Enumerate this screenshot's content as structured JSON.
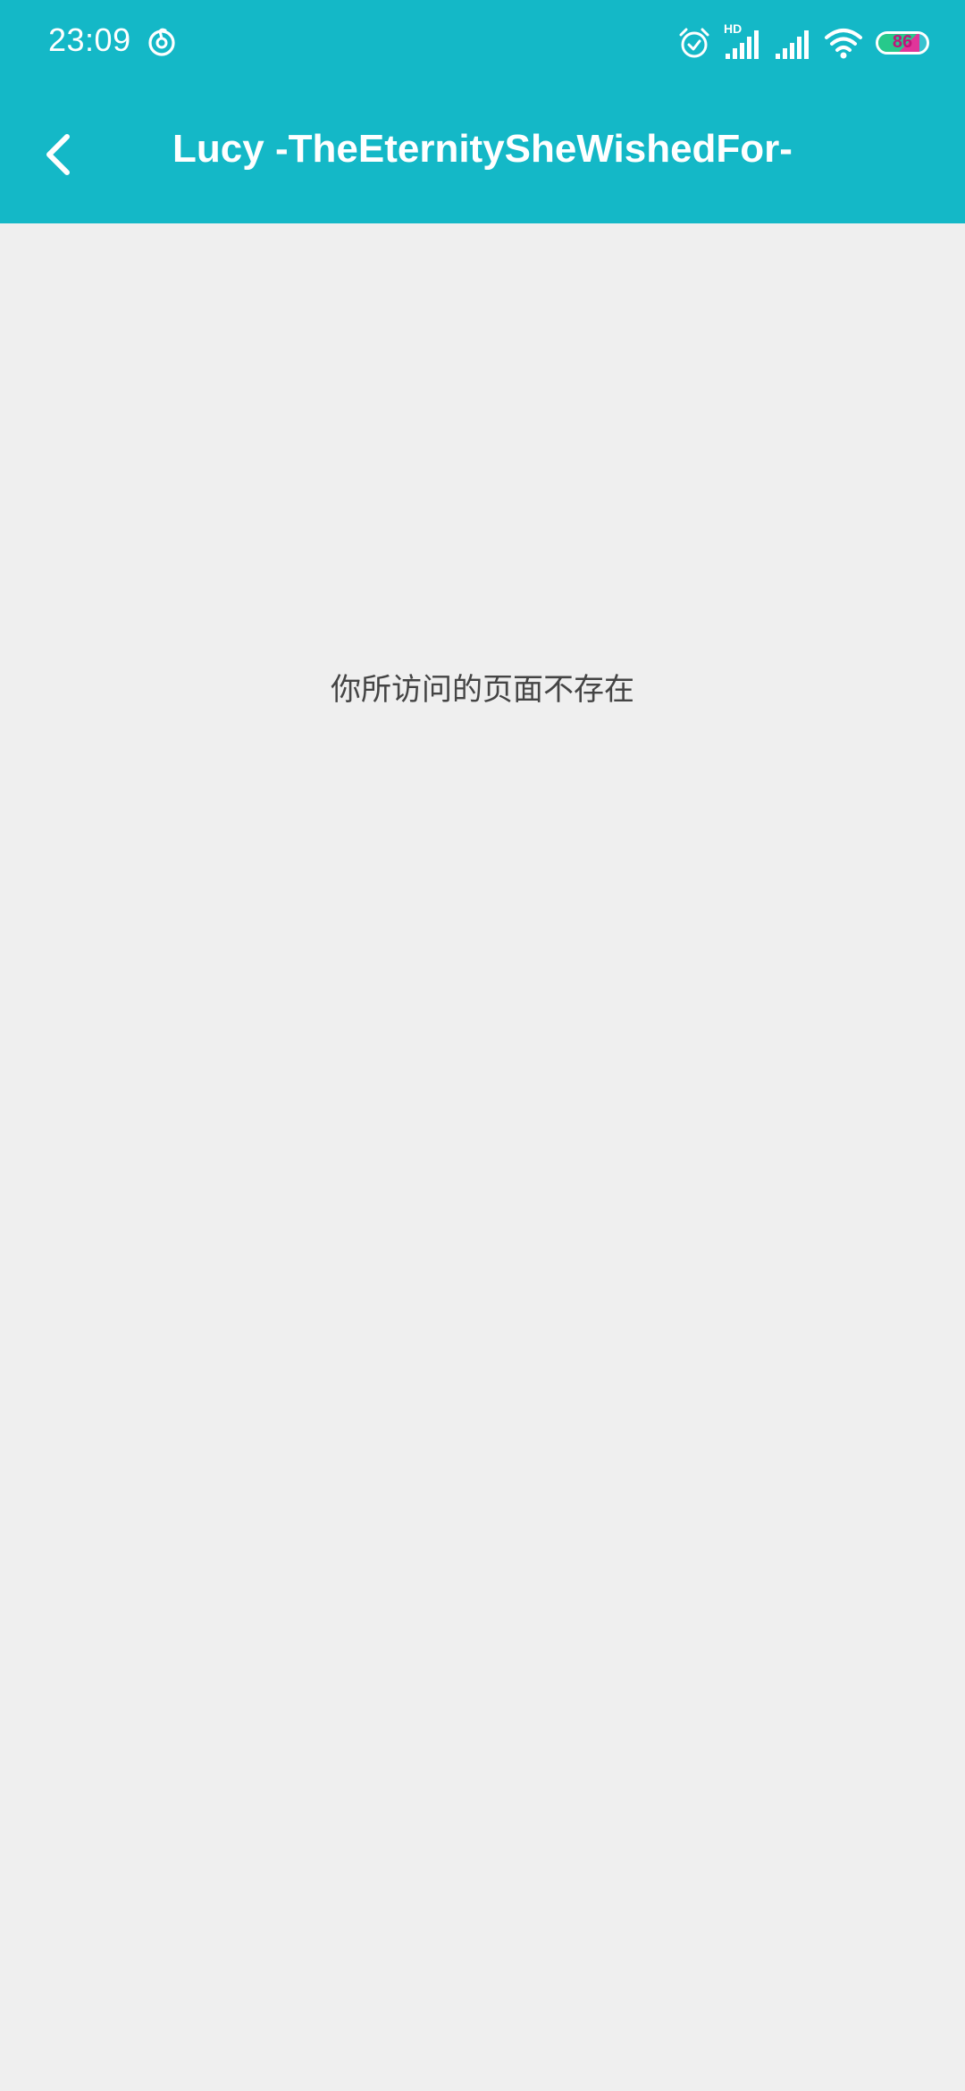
{
  "status_bar": {
    "time": "23:09",
    "network_label": "HD",
    "battery_level": "86",
    "icons": [
      "netease-music-icon",
      "alarm-icon",
      "signal-hd-icon",
      "signal-icon",
      "wifi-icon",
      "battery-icon"
    ],
    "battery_fill_color": "#27c98b",
    "battery_accent_color": "#e0359a"
  },
  "app_bar": {
    "title": "Lucy -TheEternitySheWishedFor-",
    "back_icon": "chevron-left-icon",
    "background_color": "#14b8c7"
  },
  "content": {
    "message": "你所访问的页面不存在",
    "background_color": "#efefef"
  }
}
